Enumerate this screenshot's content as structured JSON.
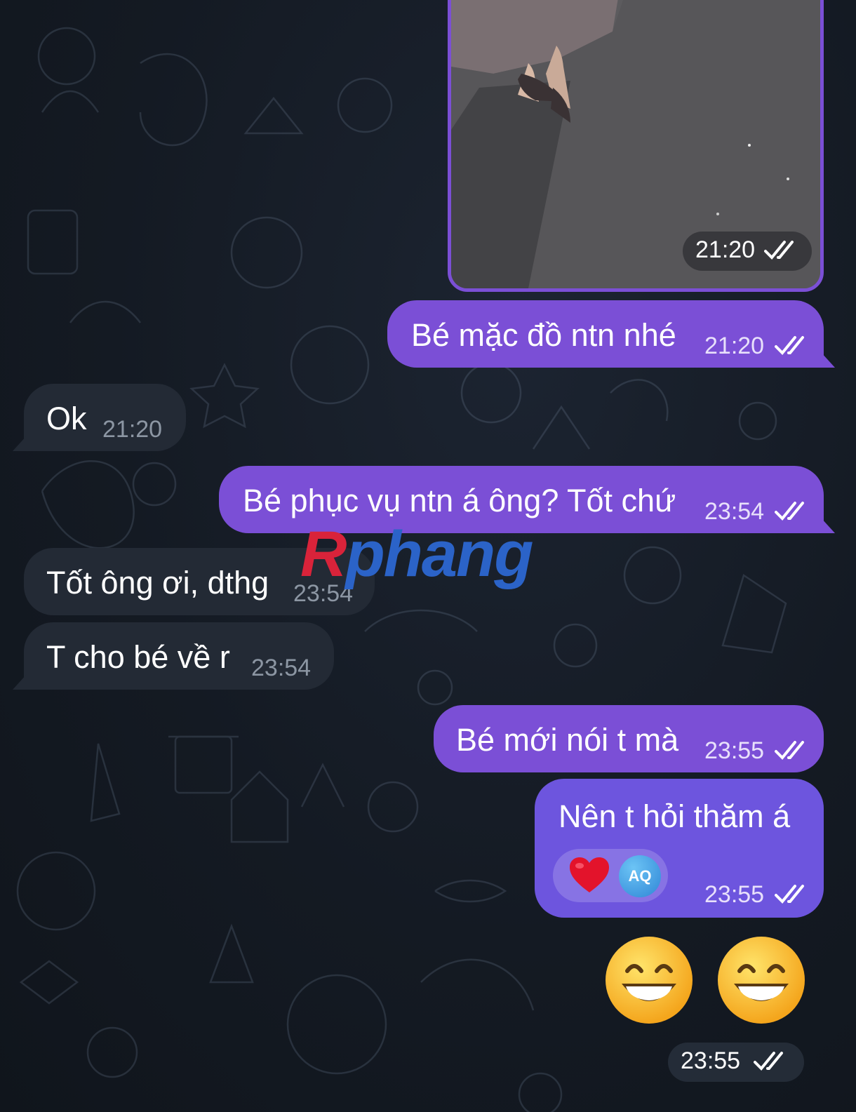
{
  "photo_message": {
    "time": "21:20",
    "status_icon": "double-check-icon"
  },
  "messages": [
    {
      "id": "m1",
      "direction": "outgoing",
      "text": "Bé mặc đồ ntn nhé",
      "time": "21:20",
      "status_icon": "double-check-icon"
    },
    {
      "id": "m2",
      "direction": "incoming",
      "text": "Ok",
      "time": "21:20"
    },
    {
      "id": "m3",
      "direction": "outgoing",
      "text": "Bé phục vụ ntn á ông? Tốt chứ",
      "time": "23:54",
      "status_icon": "double-check-icon"
    },
    {
      "id": "m4",
      "direction": "incoming",
      "text": "Tốt ông ơi, dthg",
      "time": "23:54"
    },
    {
      "id": "m5",
      "direction": "incoming",
      "text": "T cho bé về r",
      "time": "23:54"
    },
    {
      "id": "m6",
      "direction": "outgoing",
      "text": "Bé mới nói t mà",
      "time": "23:55",
      "status_icon": "double-check-icon"
    },
    {
      "id": "m7",
      "direction": "outgoing",
      "text": "Nên t hỏi thăm á",
      "time": "23:55",
      "status_icon": "double-check-icon",
      "reaction": {
        "emoji": "❤️",
        "reactor_initials": "AQ"
      }
    }
  ],
  "emoji_message": {
    "emojis": [
      "😁",
      "😁"
    ],
    "time": "23:55",
    "status_icon": "double-check-icon"
  },
  "watermark": {
    "first": "R",
    "rest": "phang"
  },
  "colors": {
    "outgoing_bubble": "#7b4fd6",
    "incoming_bubble": "#232a35",
    "background": "#141a23"
  }
}
